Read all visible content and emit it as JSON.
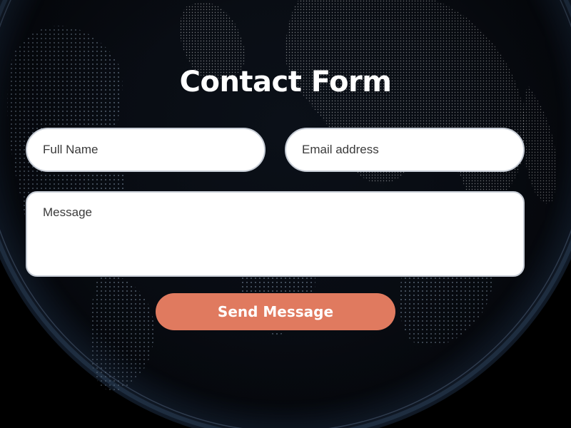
{
  "form": {
    "title": "Contact Form",
    "name_placeholder": "Full Name",
    "email_placeholder": "Email address",
    "message_placeholder": "Message",
    "submit_label": "Send Message"
  },
  "colors": {
    "background": "#000000",
    "button": "#e07a5f",
    "field_border": "#c7cdd6"
  }
}
